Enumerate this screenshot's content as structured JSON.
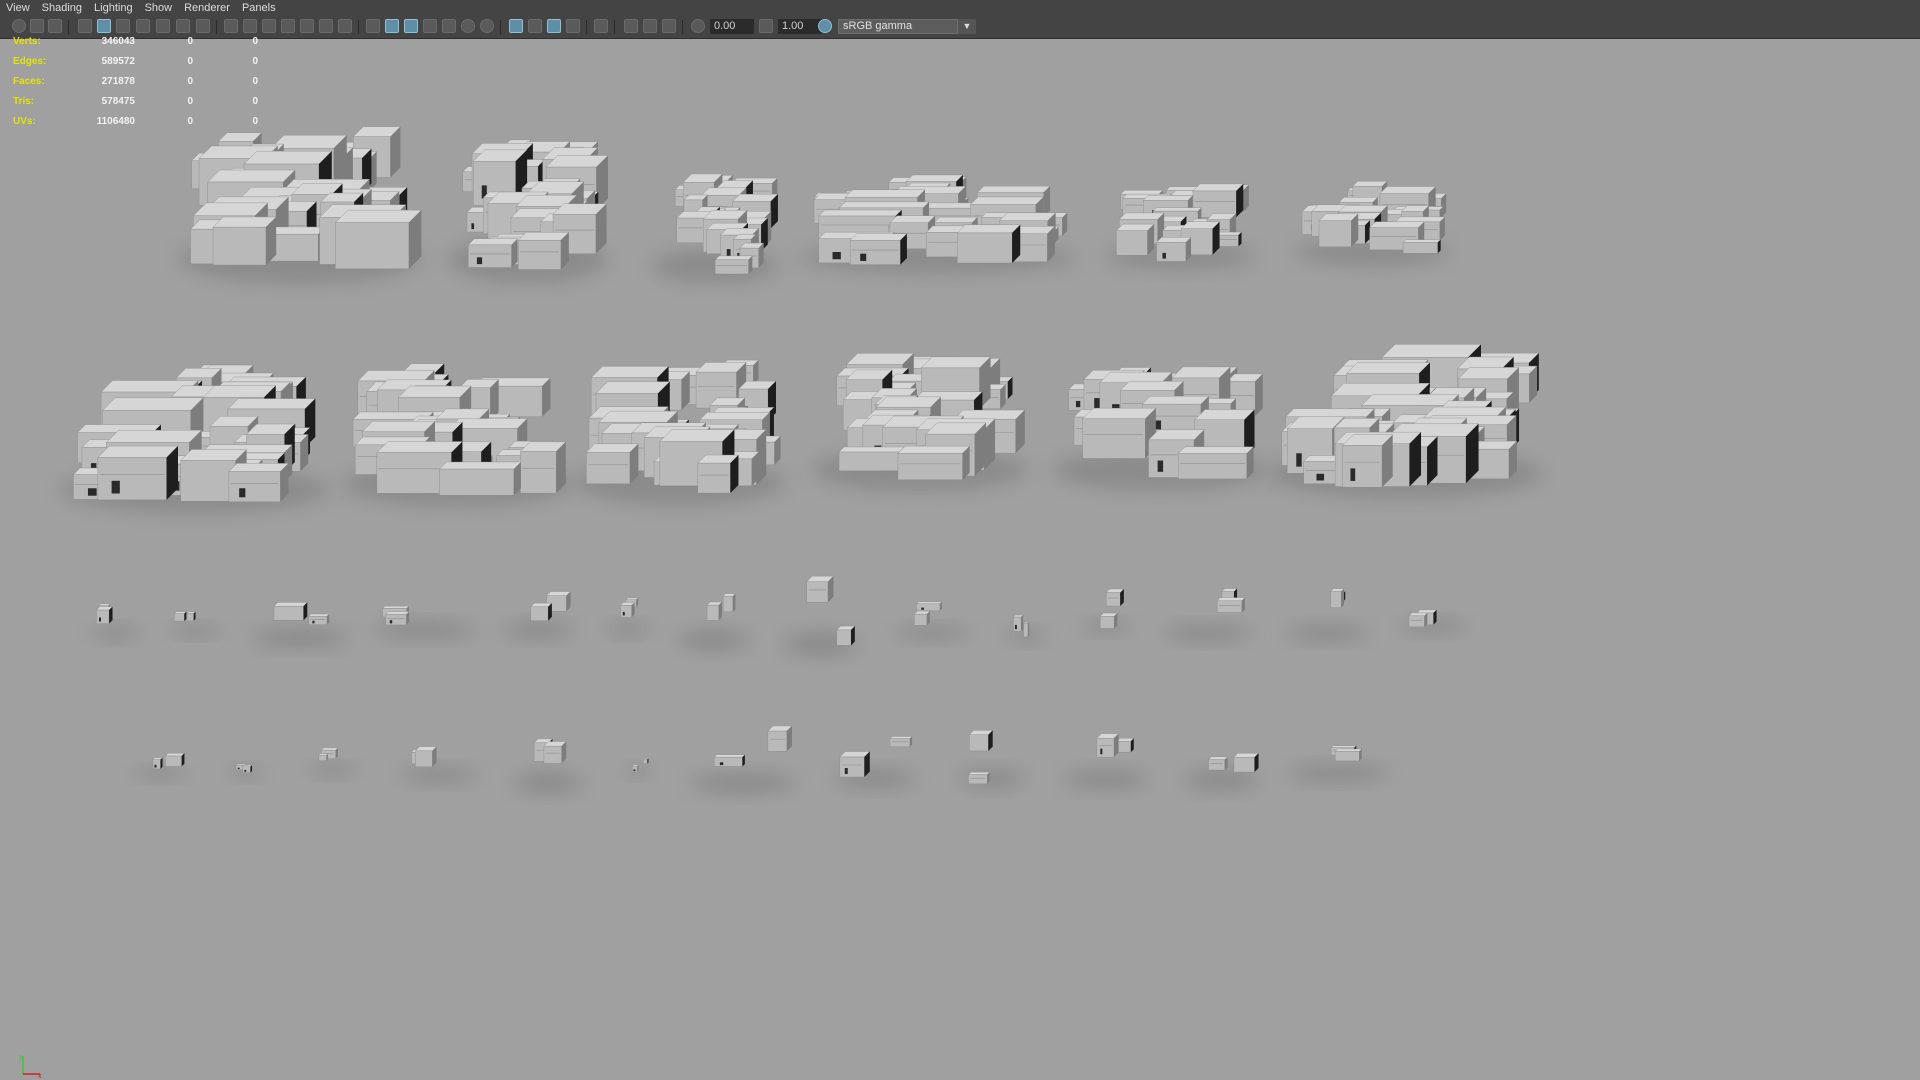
{
  "menu": [
    "View",
    "Shading",
    "Lighting",
    "Show",
    "Renderer",
    "Panels"
  ],
  "toolbar": {
    "exposure_value": "0.00",
    "gamma_value": "1.00",
    "colorspace": "sRGB gamma"
  },
  "hud": {
    "rows": [
      {
        "label": "Verts:",
        "total": "346043",
        "selected": "0",
        "tris": "0"
      },
      {
        "label": "Edges:",
        "total": "589572",
        "selected": "0",
        "tris": "0"
      },
      {
        "label": "Faces:",
        "total": "271878",
        "selected": "0",
        "tris": "0"
      },
      {
        "label": "Tris:",
        "total": "578475",
        "selected": "0",
        "tris": "0"
      },
      {
        "label": "UVs:",
        "total": "1106480",
        "selected": "0",
        "tris": "0"
      }
    ]
  },
  "colors": {
    "viewport_bg": "#a0a0a0",
    "ui_bg": "#444444",
    "hud_label": "#e4e400",
    "hud_value": "#f2f2f2",
    "active_button": "#5f8fa6"
  },
  "axis_labels": {
    "y": "y",
    "x": "x"
  }
}
